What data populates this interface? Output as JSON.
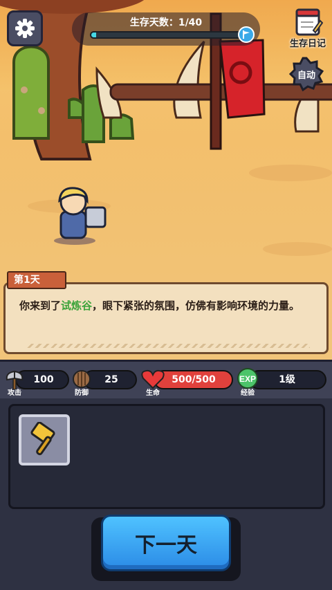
{
  "hud": {
    "day_label": "生存天数：1/40",
    "day_progress": 0.03,
    "diary_label": "生存日记",
    "auto_label": "自动"
  },
  "dialog": {
    "tag": "第1天",
    "text_before": "你来到了",
    "text_highlight": "试炼谷",
    "text_after": "，眼下紧张的氛围，仿佛有影响环境的力量。"
  },
  "stats": [
    {
      "label": "攻击",
      "value": "100",
      "icon": "axe-icon"
    },
    {
      "label": "防御",
      "value": "25",
      "icon": "shield-icon"
    },
    {
      "label": "生命",
      "value": "500/500",
      "icon": "heart-icon"
    },
    {
      "label": "经验",
      "value": "1级",
      "icon": "exp-icon"
    }
  ],
  "inventory": {
    "items": [
      {
        "icon": "golden-hammer-icon"
      }
    ]
  },
  "actions": {
    "next_day": "下一天"
  },
  "colors": {
    "progress": "#46d9e6",
    "highlight": "#3ba33a",
    "next_button": "#3aa6f5",
    "health_bar": "#e0413c"
  }
}
